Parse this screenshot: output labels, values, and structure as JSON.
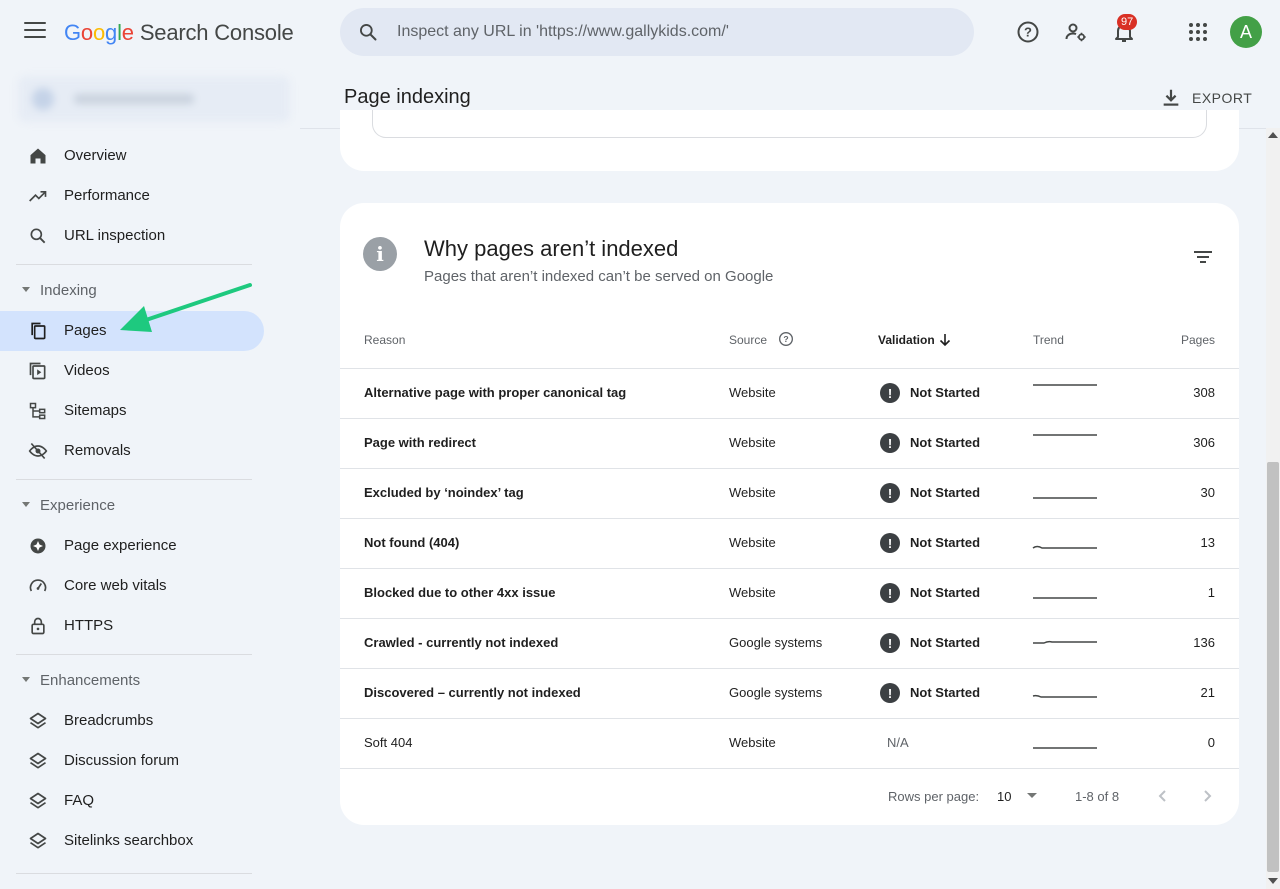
{
  "header": {
    "logo_letters": [
      "G",
      "o",
      "o",
      "g",
      "l",
      "e"
    ],
    "app_name": "Search Console",
    "search_placeholder": "Inspect any URL in 'https://www.gallykids.com/'",
    "notification_count": "97",
    "avatar_letter": "A"
  },
  "sidebar": {
    "top_items": [
      {
        "label": "Overview",
        "icon": "home-icon"
      },
      {
        "label": "Performance",
        "icon": "trending-icon"
      },
      {
        "label": "URL inspection",
        "icon": "search-icon"
      }
    ],
    "sections": [
      {
        "title": "Indexing",
        "items": [
          {
            "label": "Pages",
            "icon": "pages-icon",
            "active": true
          },
          {
            "label": "Videos",
            "icon": "video-icon"
          },
          {
            "label": "Sitemaps",
            "icon": "sitemap-icon"
          },
          {
            "label": "Removals",
            "icon": "removals-icon"
          }
        ]
      },
      {
        "title": "Experience",
        "items": [
          {
            "label": "Page experience",
            "icon": "page-experience-icon"
          },
          {
            "label": "Core web vitals",
            "icon": "gauge-icon"
          },
          {
            "label": "HTTPS",
            "icon": "lock-icon"
          }
        ]
      },
      {
        "title": "Enhancements",
        "items": [
          {
            "label": "Breadcrumbs",
            "icon": "layers-icon"
          },
          {
            "label": "Discussion forum",
            "icon": "layers-icon"
          },
          {
            "label": "FAQ",
            "icon": "layers-icon"
          },
          {
            "label": "Sitelinks searchbox",
            "icon": "layers-icon"
          }
        ]
      }
    ]
  },
  "main": {
    "page_title": "Page indexing",
    "export_label": "EXPORT",
    "card": {
      "title": "Why pages aren’t indexed",
      "subtitle": "Pages that aren’t indexed can’t be served on Google",
      "columns": {
        "reason": "Reason",
        "source": "Source",
        "validation": "Validation",
        "trend": "Trend",
        "pages": "Pages"
      },
      "rows": [
        {
          "reason": "Alternative page with proper canonical tag",
          "source": "Website",
          "validation": "Not Started",
          "pages": "308",
          "bold": true
        },
        {
          "reason": "Page with redirect",
          "source": "Website",
          "validation": "Not Started",
          "pages": "306",
          "bold": true
        },
        {
          "reason": "Excluded by ‘noindex’ tag",
          "source": "Website",
          "validation": "Not Started",
          "pages": "30",
          "bold": true
        },
        {
          "reason": "Not found (404)",
          "source": "Website",
          "validation": "Not Started",
          "pages": "13",
          "bold": true
        },
        {
          "reason": "Blocked due to other 4xx issue",
          "source": "Website",
          "validation": "Not Started",
          "pages": "1",
          "bold": true
        },
        {
          "reason": "Crawled - currently not indexed",
          "source": "Google systems",
          "validation": "Not Started",
          "pages": "136",
          "bold": true
        },
        {
          "reason": "Discovered – currently not indexed",
          "source": "Google systems",
          "validation": "Not Started",
          "pages": "21",
          "bold": true
        },
        {
          "reason": "Soft 404",
          "source": "Website",
          "validation": "N/A",
          "pages": "0",
          "bold": false
        }
      ],
      "pagination": {
        "rows_per_page_label": "Rows per page:",
        "rows_per_page": "10",
        "range": "1-8 of 8"
      }
    }
  },
  "colors": {
    "accent": "#d3e3fd",
    "annotation_arrow": "#1ec97f",
    "badge": "#d93025",
    "avatar": "#43a047"
  }
}
